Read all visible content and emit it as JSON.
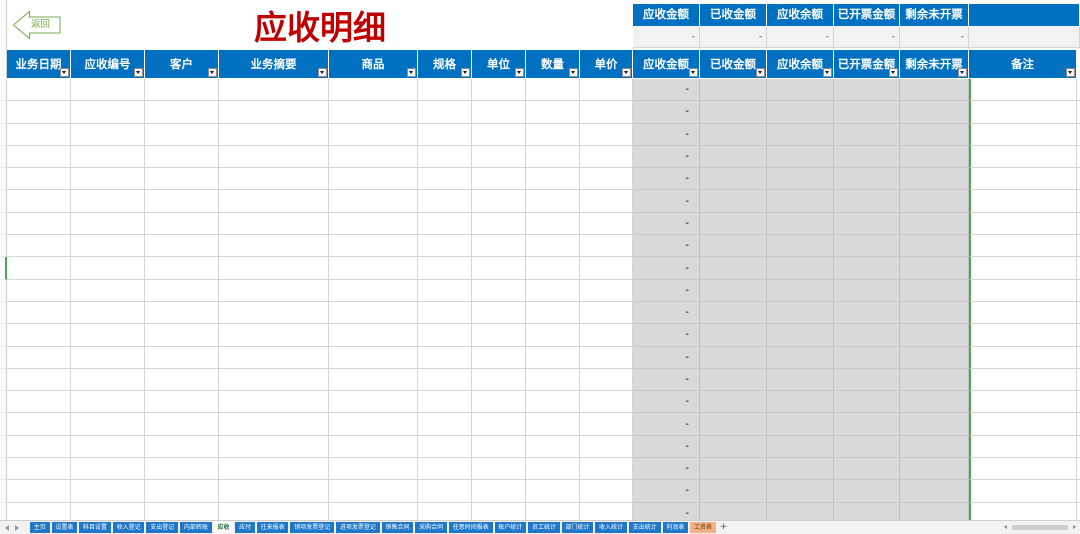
{
  "title": "应收明细",
  "back_button": {
    "label": "返回"
  },
  "summary": {
    "headers": [
      "应收金额",
      "已收金额",
      "应收余额",
      "已开票金额",
      "剩余未开票"
    ],
    "values": [
      "-",
      "-",
      "-",
      "-",
      "-"
    ]
  },
  "table": {
    "columns": [
      "业务日期",
      "应收编号",
      "客户",
      "业务摘要",
      "商品",
      "规格",
      "单位",
      "数量",
      "单价",
      "应收金额",
      "已收金额",
      "应收余额",
      "已开票金额",
      "剩余未开票",
      "备注"
    ],
    "rows": [
      [
        "",
        "",
        "",
        "",
        "",
        "",
        "",
        "",
        "",
        "-",
        "",
        "",
        "",
        "",
        ""
      ],
      [
        "",
        "",
        "",
        "",
        "",
        "",
        "",
        "",
        "",
        "-",
        "",
        "",
        "",
        "",
        ""
      ],
      [
        "",
        "",
        "",
        "",
        "",
        "",
        "",
        "",
        "",
        "-",
        "",
        "",
        "",
        "",
        ""
      ],
      [
        "",
        "",
        "",
        "",
        "",
        "",
        "",
        "",
        "",
        "-",
        "",
        "",
        "",
        "",
        ""
      ],
      [
        "",
        "",
        "",
        "",
        "",
        "",
        "",
        "",
        "",
        "-",
        "",
        "",
        "",
        "",
        ""
      ],
      [
        "",
        "",
        "",
        "",
        "",
        "",
        "",
        "",
        "",
        "-",
        "",
        "",
        "",
        "",
        ""
      ],
      [
        "",
        "",
        "",
        "",
        "",
        "",
        "",
        "",
        "",
        "-",
        "",
        "",
        "",
        "",
        ""
      ],
      [
        "",
        "",
        "",
        "",
        "",
        "",
        "",
        "",
        "",
        "-",
        "",
        "",
        "",
        "",
        ""
      ],
      [
        "",
        "",
        "",
        "",
        "",
        "",
        "",
        "",
        "",
        "-",
        "",
        "",
        "",
        "",
        ""
      ],
      [
        "",
        "",
        "",
        "",
        "",
        "",
        "",
        "",
        "",
        "-",
        "",
        "",
        "",
        "",
        ""
      ],
      [
        "",
        "",
        "",
        "",
        "",
        "",
        "",
        "",
        "",
        "-",
        "",
        "",
        "",
        "",
        ""
      ],
      [
        "",
        "",
        "",
        "",
        "",
        "",
        "",
        "",
        "",
        "-",
        "",
        "",
        "",
        "",
        ""
      ],
      [
        "",
        "",
        "",
        "",
        "",
        "",
        "",
        "",
        "",
        "-",
        "",
        "",
        "",
        "",
        ""
      ],
      [
        "",
        "",
        "",
        "",
        "",
        "",
        "",
        "",
        "",
        "-",
        "",
        "",
        "",
        "",
        ""
      ],
      [
        "",
        "",
        "",
        "",
        "",
        "",
        "",
        "",
        "",
        "-",
        "",
        "",
        "",
        "",
        ""
      ],
      [
        "",
        "",
        "",
        "",
        "",
        "",
        "",
        "",
        "",
        "-",
        "",
        "",
        "",
        "",
        ""
      ],
      [
        "",
        "",
        "",
        "",
        "",
        "",
        "",
        "",
        "",
        "-",
        "",
        "",
        "",
        "",
        ""
      ],
      [
        "",
        "",
        "",
        "",
        "",
        "",
        "",
        "",
        "",
        "-",
        "",
        "",
        "",
        "",
        ""
      ],
      [
        "",
        "",
        "",
        "",
        "",
        "",
        "",
        "",
        "",
        "-",
        "",
        "",
        "",
        "",
        ""
      ],
      [
        "",
        "",
        "",
        "",
        "",
        "",
        "",
        "",
        "",
        "-",
        "",
        "",
        "",
        "",
        ""
      ]
    ]
  },
  "sheet_tabs": [
    "主页",
    "设置表",
    "科目设置",
    "收入登记",
    "支出登记",
    "内部转账",
    "应收",
    "应付",
    "往来报表",
    "销项发票登记",
    "进项发票登记",
    "销售合同",
    "采购合同",
    "任意时间报表",
    "账户统计",
    "员工统计",
    "部门统计",
    "收入统计",
    "支出统计",
    "利润表",
    "工资表"
  ],
  "add_sheet_label": "+",
  "active_sheet_tab_index": 6,
  "colors": {
    "header_blue": "#0070c0",
    "title_red": "#c00000",
    "formula_grey": "#d9d9d9",
    "selection_green": "#4ea64e",
    "tab_blue": "#1f77c9",
    "tab_orange": "#f4b183",
    "back_button_green": "#70ad47"
  }
}
